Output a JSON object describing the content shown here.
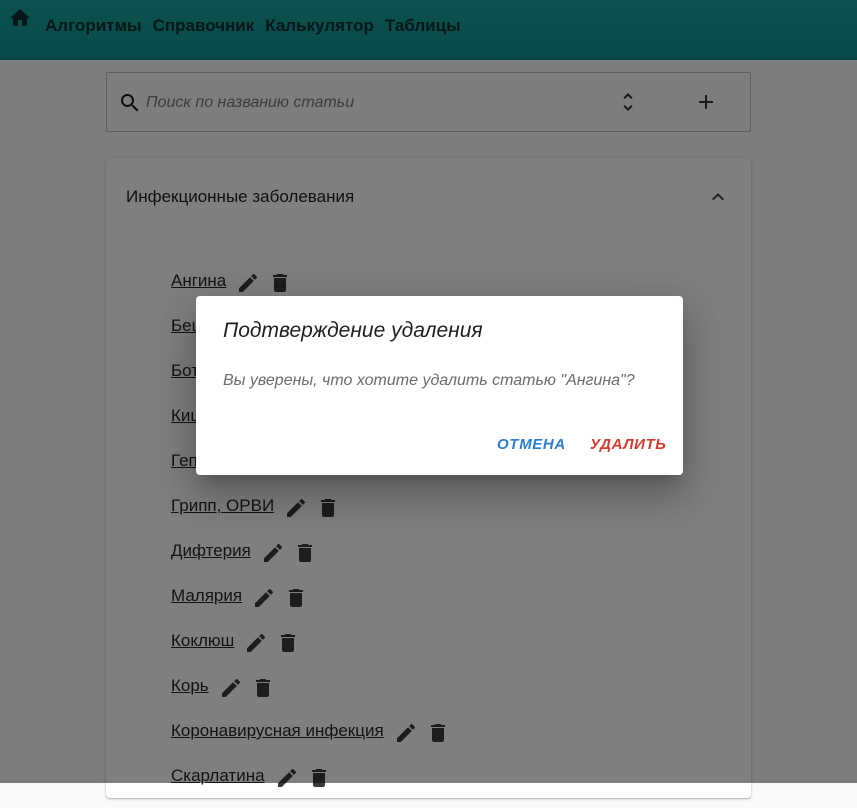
{
  "nav": {
    "items": [
      "Алгоритмы",
      "Справочник",
      "Калькулятор",
      "Таблицы"
    ]
  },
  "search": {
    "placeholder": "Поиск по названию статьи",
    "value": ""
  },
  "panel": {
    "title": "Инфекционные заболевания",
    "articles": [
      "Ангина",
      "Бешенство",
      "Ботулизм",
      "Кишечные инфекции",
      "Гепатиты",
      "Грипп, ОРВИ",
      "Дифтерия",
      "Малярия",
      "Коклюш",
      "Корь",
      "Коронавирусная инфекция",
      "Скарлатина"
    ]
  },
  "dialog": {
    "title": "Подтверждение удаления",
    "message": "Вы уверены, что хотите удалить статью \"Ангина\"?",
    "cancel_label": "ОТМЕНА",
    "delete_label": "УДАЛИТЬ"
  },
  "icons": {
    "home": "home-icon",
    "search": "search-icon",
    "sort": "sort-icon",
    "add": "add-icon",
    "chevron": "chevron-up-icon",
    "edit": "edit-icon",
    "delete": "trash-icon"
  },
  "colors": {
    "topbar": "#129b98",
    "cancel": "#2a7fd0",
    "delete": "#d63a2c"
  }
}
